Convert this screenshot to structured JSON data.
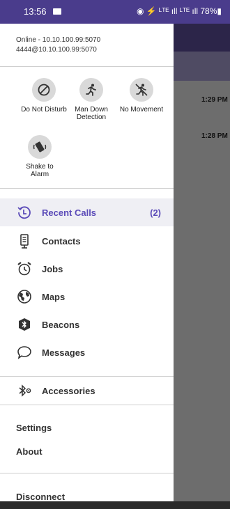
{
  "status_bar": {
    "time": "13:56",
    "right": "◉ ⚡ ᴸᵀᴱ ıll ᴸᵀᴱ ıll 78%▮"
  },
  "account": {
    "line1": "Online - 10.10.100.99:5070",
    "line2": "4444@10.10.100.99:5070"
  },
  "quick_actions": [
    {
      "label": "Do Not Disturb",
      "icon": "block-icon"
    },
    {
      "label": "Man Down Detection",
      "icon": "running-person-icon"
    },
    {
      "label": "No Movement",
      "icon": "no-movement-icon"
    },
    {
      "label": "Shake to Alarm",
      "icon": "shake-phone-icon"
    }
  ],
  "menu": [
    {
      "label": "Recent Calls",
      "count": "(2)",
      "icon": "recent-calls-icon",
      "active": true
    },
    {
      "label": "Contacts",
      "icon": "contacts-icon"
    },
    {
      "label": "Jobs",
      "icon": "alarm-clock-icon"
    },
    {
      "label": "Maps",
      "icon": "globe-icon"
    },
    {
      "label": "Beacons",
      "icon": "beacon-icon"
    },
    {
      "label": "Messages",
      "icon": "chat-bubble-icon"
    }
  ],
  "accessories": {
    "label": "Accessories",
    "icon": "bluetooth-icon"
  },
  "settings": "Settings",
  "about": "About",
  "disconnect": "Disconnect",
  "background": {
    "time1": "1:29 PM",
    "time2": "1:28 PM"
  },
  "colors": {
    "accent": "#5b4bb8",
    "header": "#4a3c8c",
    "overlay": "#6d6d6d"
  }
}
